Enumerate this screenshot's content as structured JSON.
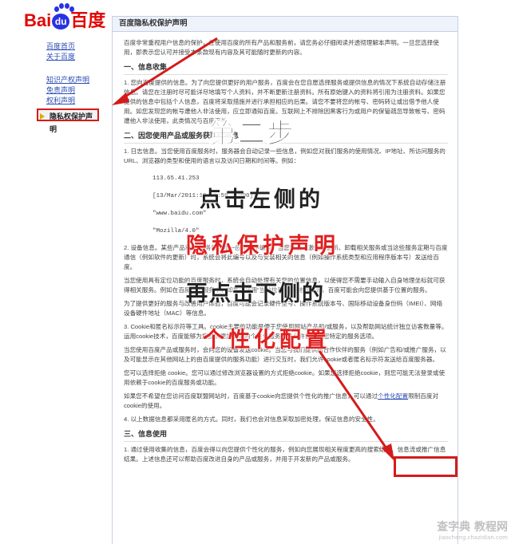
{
  "logo": {
    "latin": "Bai",
    "du": "du",
    "cn": "百度"
  },
  "nav": {
    "group1": [
      "百度首页",
      "关于百度"
    ],
    "group2": [
      "知识产权声明",
      "免责声明",
      "权利声明"
    ],
    "active": "隐私权保护声明"
  },
  "panel": {
    "title": "百度隐私权保护声明"
  },
  "content": {
    "intro": "百度非常重视用户信息的保护，在使用百度的所有产品和服务前，请您务必仔细阅读并透彻理解本声明。一旦您选择使用，即表示您认可并接受本条款现有内容及其可能随时更新的内容。",
    "h1": "一、信息收集",
    "p1": "1.   您向百度提供的信息。为了向您提供更好的用户服务，百度会在您自愿选择服务或提供信息的情况下系统自动存储注册信息。请您在注册时尽可能详尽地填写个人资料，并不断更新注册资料。所有原始键入的资料将引用为注册资料。如果您提供的信息中包括个人信息，百度将采取措施并进行承担相应的后果。请您不要将您的帐号、密码转让或出借予他人使用。如您发现您的帐号遭他人非法使用，应立即通知百度。互联网上不排除因黑客行为或用户的保管疏忽导致帐号、密码遭他人非法使用，此类情况与百度无关。",
    "h2": "二、因您使用产品或服务获取的信息",
    "p2": "1.   日志信息。当您使用百度服务时，服务器会自动记录一些信息，例如您对我们服务的使用情况、IP地址、所访问服务的URL、浏览器的类型和使用的语言以及访问日期和时间等。例如：",
    "code": [
      "113.65.41.253",
      "[13/Mar/2011:12:59:59 +0800]",
      "\"www.baidu.com\"",
      "\"Mozilla/4.0\""
    ],
    "p3": "2.   设备信息。某些产品和/或服务包含唯一应用程序编号。当您安装、激活、更新、卸载相关服务或当这些服务定期与百度通信（例如软件的更新）时，系统会将此编号以及与安装相关的信息（例如操作系统类型和应用程序版本号）发送给百度。",
    "p4": "当您使用具有定位功能的百度服务时，系统会自动处理有关您的位置信息，以使得您不需要手动输入自身地理坐标就可获得相关服务。例如在百度地图服务中，如果您使用“当前位置”进行地理查询，百度可能会向您提供基于位置的服务。",
    "p5": "为了提供更好的服务与改善用户体验，百度可能会记录硬件型号、操作系统版本号、国际移动设备身份码（IMEI）、网络设备硬件地址（MAC）等信息。",
    "p6": "3.   Cookie和匿名标示符等工具。cookie主要的功能是便于您使用网站产品和/或服务，以及帮助网站统计独立访客数量等。运用cookie技术，百度能够为您提供更加周到的个性化服务，并允许您设定您特定的服务选项。",
    "p7": "当您使用百度产品或服务时，会向您的设备发送cookie。当您与我们提供给合作伙伴的服务（例如广告和/或推广服务，以及可能显示在其他网站上的由百度提供的服务功能）进行交互时，我们允许cookie或者匿名标示符发送给百度服务器。",
    "p8": "您可以选择拒绝 cookie。您可以通过修改浏览器设置的方式拒绝cookie。如果您选择拒绝cookie，则您可能无法登录或使用依赖于cookie的百度服务或功能。",
    "p9a": "如果您不希望在您访问百度联盟网站时，百度基于cookie向您提供个性化的推广信息，可以通过",
    "p9link": "个性化配置",
    "p9b": "限制百度对cookie的使用。",
    "p10": "4.   以上数据信息都采用匿名的方式。同时，我们也会对信息采取加密处理，保证信息的安全性。",
    "h3": "三、信息使用",
    "p11": "1.   通过使用收集的信息，百度会得以向您提供个性化的服务，例如向您展现相关程度更高的搜索结果、信息流或推广信息结果。上述信息还可以帮助百度改进自身的产品或服务，并用于开发新的产品或服务。"
  },
  "overlay": {
    "step": "第二步",
    "line1": "点击左侧的",
    "line2": "隐私保护声明",
    "line3": "再点击下侧的",
    "line4": "个性化配置"
  },
  "watermark": {
    "main": "查字典 教程网",
    "sub": "jiaocheng.chazidian.com"
  }
}
